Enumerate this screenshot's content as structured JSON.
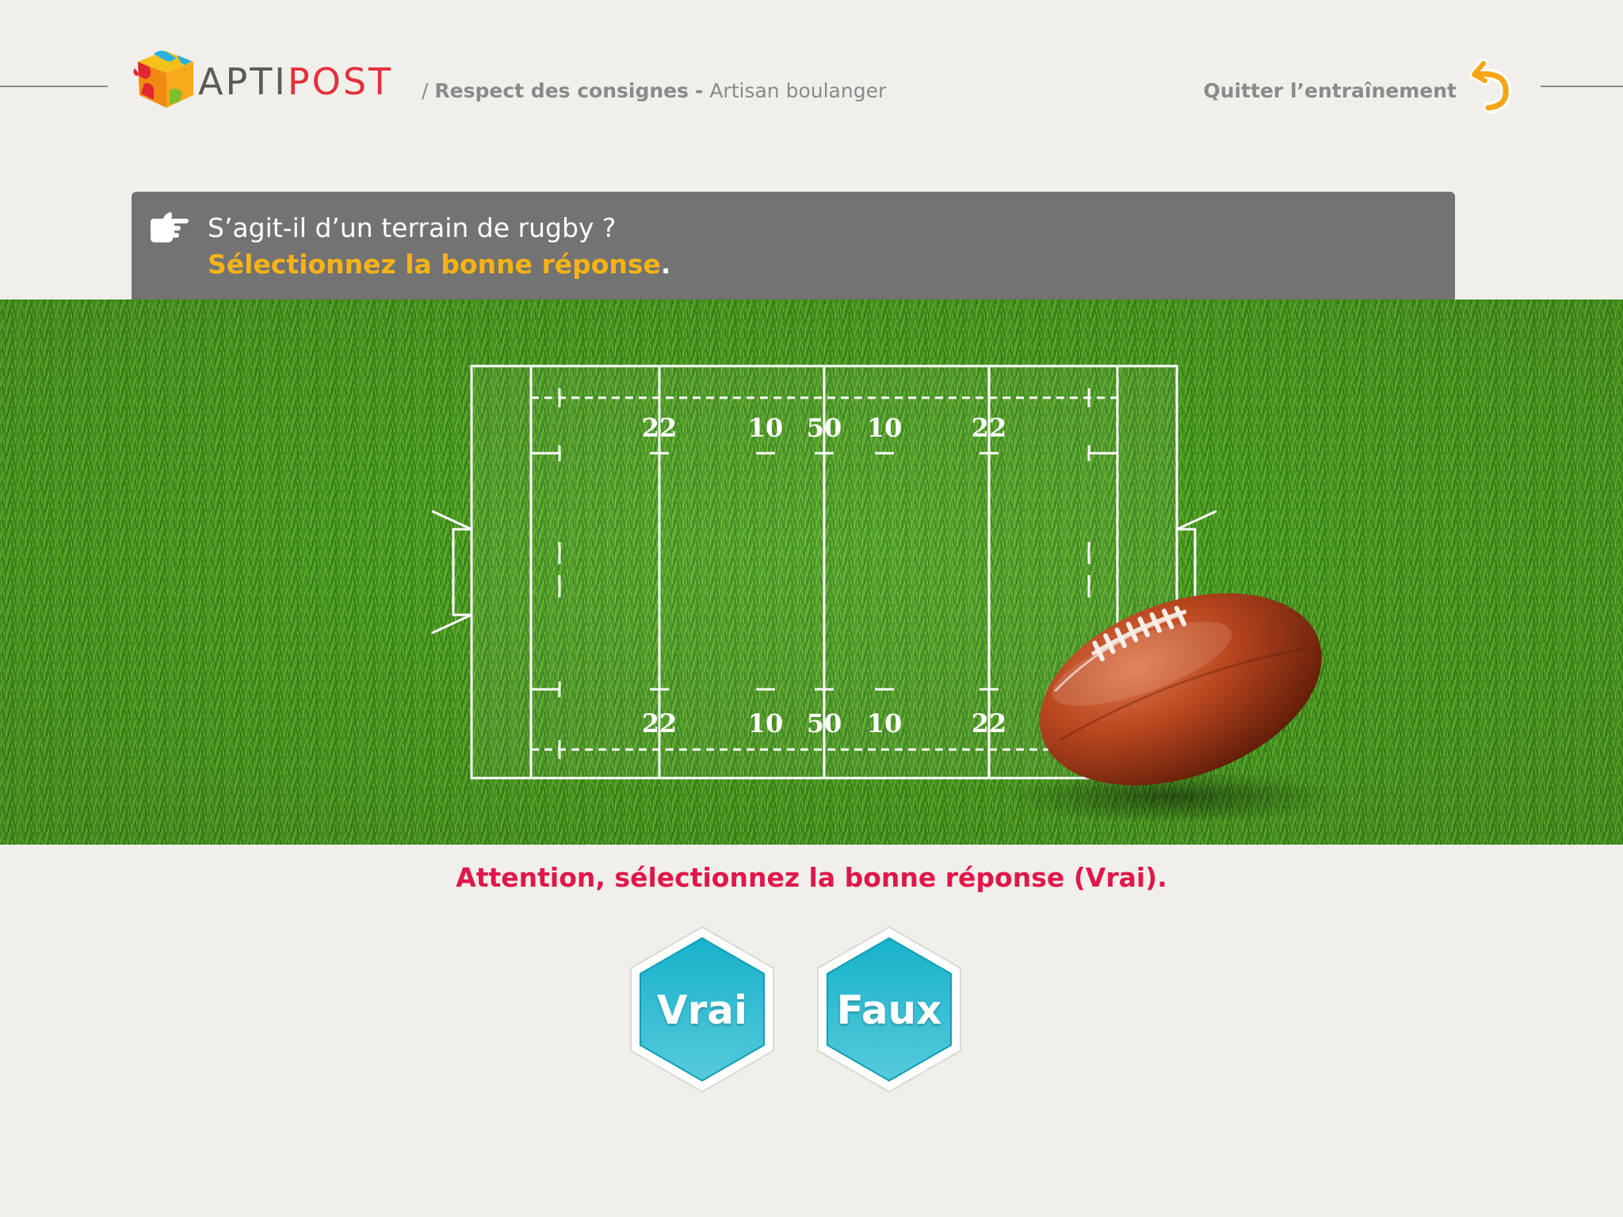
{
  "header": {
    "logo_text_part1": "Apti",
    "logo_text_part2": "Post",
    "breadcrumb_separator": "/",
    "breadcrumb_section": "Respect des consignes",
    "breadcrumb_dash": "-",
    "breadcrumb_job": "Artisan boulanger",
    "quit_label": "Quitter l’entraînement",
    "quit_icon": "return-arrow-icon"
  },
  "instruction": {
    "icon": "pointing-hand-icon",
    "question": "S’agit-il d’un terrain de rugby ?",
    "directive": "Sélectionnez la bonne réponse",
    "directive_punct": "."
  },
  "field": {
    "top_labels": [
      "22",
      "10",
      "50",
      "10",
      "22"
    ],
    "bottom_labels": [
      "22",
      "10",
      "50",
      "10",
      "22"
    ],
    "ball_icon": "american-football-icon"
  },
  "warning": "Attention, sélectionnez la bonne réponse (Vrai).",
  "answers": {
    "vrai": "Vrai",
    "faux": "Faux"
  },
  "colors": {
    "accent_orange": "#f7b316",
    "warning_red": "#e0174a",
    "button_teal": "#1cb5cd",
    "panel_gray": "#737373",
    "background": "#f0efea"
  }
}
